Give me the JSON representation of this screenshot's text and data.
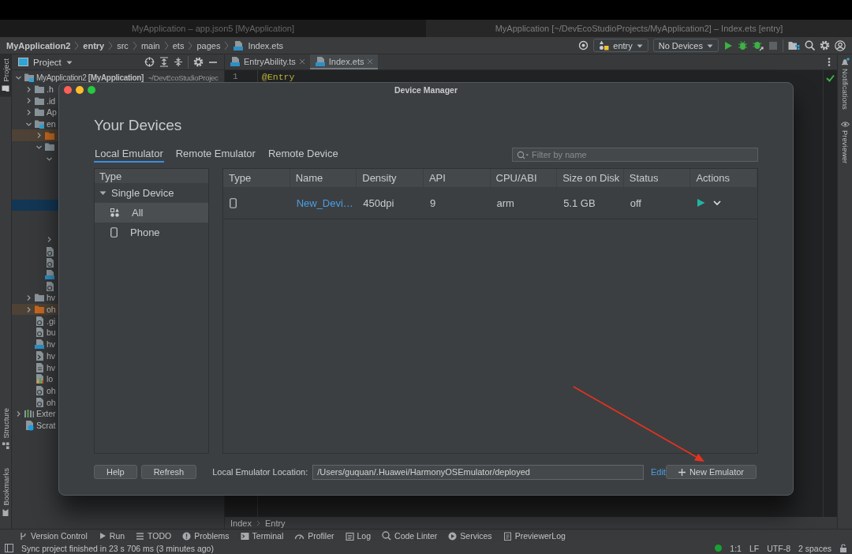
{
  "window_tabs": [
    {
      "title": "MyApplication – app.json5 [MyApplication]",
      "selected": false
    },
    {
      "title": "MyApplication [~/DevEcoStudioProjects/MyApplication2] – Index.ets [entry]",
      "selected": true
    }
  ],
  "breadcrumbs": [
    {
      "label": "MyApplication2",
      "bold": true
    },
    {
      "label": "entry",
      "bold": true
    },
    {
      "label": "src",
      "bold": false
    },
    {
      "label": "main",
      "bold": false
    },
    {
      "label": "ets",
      "bold": false
    },
    {
      "label": "pages",
      "bold": false
    },
    {
      "label": "Index.ets",
      "bold": false
    }
  ],
  "toolbar": {
    "module": "entry",
    "device": "No Devices"
  },
  "left_stripe": {
    "top": [
      {
        "label": "Project",
        "selected": true
      }
    ],
    "bottom": [
      {
        "label": "Structure",
        "selected": false
      },
      {
        "label": "Bookmarks",
        "selected": false
      }
    ]
  },
  "right_stripe": [
    {
      "label": "Notifications"
    },
    {
      "label": "Previewer"
    }
  ],
  "project_panel": {
    "title": "Project",
    "tree": [
      {
        "label": "MyApplication2",
        "tag": "[MyApplication]",
        "path": "~/DevEcoStudioProjec",
        "kind": "module",
        "expanded": true,
        "selected": false,
        "children": [
          {
            "label": ".h",
            "kind": "folder",
            "expanded": false,
            "selected": false
          },
          {
            "label": ".id",
            "kind": "folder",
            "expanded": false,
            "selected": false
          },
          {
            "label": "Ap",
            "kind": "folder",
            "expanded": false,
            "selected": false
          },
          {
            "label": "en",
            "kind": "module",
            "expanded": true,
            "selected": false,
            "children": [
              {
                "kind": "excluded-folder",
                "expanded": false,
                "selected": false
              },
              {
                "kind": "folder",
                "expanded": true,
                "selected": false,
                "children": [
                  {
                    "expanded": true,
                    "selected": false,
                    "children": [
                      {
                        "selected": false
                      },
                      {
                        "selected": false
                      },
                      {
                        "selected": false
                      },
                      {
                        "selected": true
                      },
                      {
                        "selected": false
                      },
                      {
                        "selected": false
                      }
                    ]
                  },
                  {
                    "expanded": false,
                    "selected": false
                  }
                ]
              },
              {
                "kind": "config",
                "selected": false
              },
              {
                "kind": "config",
                "selected": false
              },
              {
                "kind": "ts",
                "selected": false
              },
              {
                "kind": "config",
                "selected": false
              }
            ]
          },
          {
            "label": "hv",
            "kind": "folder",
            "expanded": false,
            "selected": false
          },
          {
            "label": "oh",
            "kind": "excluded-folder",
            "expanded": false,
            "selected": false
          },
          {
            "label": ".gi",
            "kind": "config",
            "selected": false
          },
          {
            "label": "bu",
            "kind": "config",
            "selected": false
          },
          {
            "label": "hv",
            "kind": "ts",
            "selected": false
          },
          {
            "label": "hv",
            "kind": "script",
            "selected": false
          },
          {
            "label": "hv",
            "kind": "file",
            "selected": false
          },
          {
            "label": "lo",
            "kind": "properties",
            "selected": false
          },
          {
            "label": "oh",
            "kind": "config",
            "selected": false
          },
          {
            "label": "oh",
            "kind": "config",
            "selected": false
          }
        ]
      },
      {
        "label": "Exter",
        "kind": "library",
        "expanded": false,
        "selected": false
      },
      {
        "label": "Scrat",
        "kind": "scratch",
        "selected": false
      }
    ]
  },
  "editor": {
    "tabs": [
      {
        "label": "EntryAbility.ts",
        "selected": false
      },
      {
        "label": "Index.ets",
        "selected": true
      }
    ],
    "lines": [
      {
        "number": "1",
        "code": "@Entry"
      }
    ],
    "breadcrumb": [
      "Index",
      "Entry"
    ]
  },
  "dialog": {
    "title": "Device Manager",
    "heading": "Your Devices",
    "tabs": [
      {
        "label": "Local Emulator",
        "selected": true
      },
      {
        "label": "Remote Emulator",
        "selected": false
      },
      {
        "label": "Remote Device",
        "selected": false
      }
    ],
    "filter": {
      "placeholder": "Filter by name"
    },
    "type_panel": {
      "header": "Type",
      "groups": [
        {
          "label": "Single Device",
          "expanded": true,
          "items": [
            {
              "label": "All",
              "selected": true
            },
            {
              "label": "Phone",
              "selected": false
            }
          ]
        }
      ]
    },
    "table": {
      "columns": [
        "Type",
        "Name",
        "Density",
        "API",
        "CPU/ABI",
        "Size on Disk",
        "Status",
        "Actions"
      ],
      "rows": [
        {
          "name": "New_Devi…",
          "density": "450dpi",
          "api": "9",
          "cpu_abi": "arm",
          "size_on_disk": "5.1 GB",
          "status": "off"
        }
      ]
    },
    "buttons": [
      "Help",
      "Refresh"
    ],
    "location": {
      "label": "Local Emulator Location:",
      "value": "/Users/guquan/.Huawei/HarmonyOSEmulator/deployed",
      "link": "Edit"
    },
    "new_button": "New Emulator"
  },
  "tool_windows": [
    "Version Control",
    "Run",
    "TODO",
    "Problems",
    "Terminal",
    "Profiler",
    "Log",
    "Code Linter",
    "Services",
    "PreviewerLog"
  ],
  "status_bar": {
    "message": "Sync project finished in 23 s 706 ms (3 minutes ago)",
    "position": "1:1",
    "line_separator": "LF",
    "encoding": "UTF-8",
    "indent": "2 spaces"
  }
}
